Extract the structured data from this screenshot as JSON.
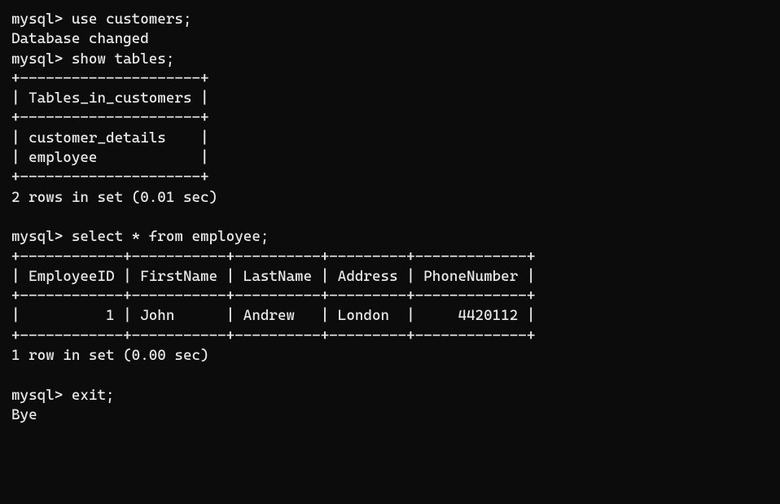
{
  "lines": {
    "0": {
      "prompt": "mysql>",
      "cmd": "use customers;"
    },
    "1": "Database changed",
    "2": {
      "prompt": "mysql>",
      "cmd": "show tables;"
    },
    "3": "+---------------------+",
    "4": "| Tables_in_customers |",
    "5": "+---------------------+",
    "6": "| customer_details    |",
    "7": "| employee            |",
    "8": "+---------------------+",
    "9": "2 rows in set (0.01 sec)",
    "10": " ",
    "11": {
      "prompt": "mysql>",
      "cmd": "select * from employee;"
    },
    "12": "+------------+-----------+----------+---------+-------------+",
    "13": "| EmployeeID | FirstName | LastName | Address | PhoneNumber |",
    "14": "+------------+-----------+----------+---------+-------------+",
    "15": "|          1 | John      | Andrew   | London  |     4420112 |",
    "16": "+------------+-----------+----------+---------+-------------+",
    "17": "1 row in set (0.00 sec)",
    "18": " ",
    "19": {
      "prompt": "mysql>",
      "cmd": "exit;"
    },
    "20": "Bye"
  },
  "tables_result": {
    "header": "Tables_in_customers",
    "rows": [
      "customer_details",
      "employee"
    ],
    "row_count": 2,
    "elapsed_sec": 0.01
  },
  "employee_result": {
    "columns": [
      "EmployeeID",
      "FirstName",
      "LastName",
      "Address",
      "PhoneNumber"
    ],
    "rows": [
      {
        "EmployeeID": 1,
        "FirstName": "John",
        "LastName": "Andrew",
        "Address": "London",
        "PhoneNumber": 4420112
      }
    ],
    "row_count": 1,
    "elapsed_sec": 0.0
  }
}
